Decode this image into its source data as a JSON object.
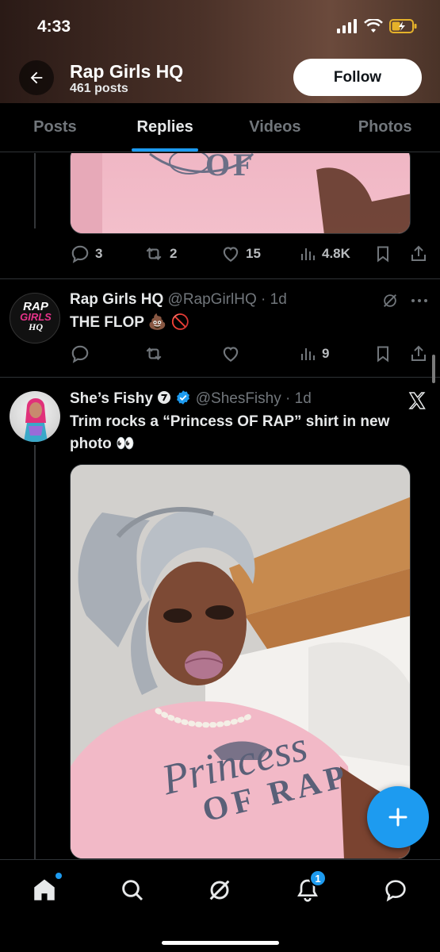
{
  "status_bar": {
    "time": "4:33"
  },
  "header": {
    "account_name": "Rap Girls HQ",
    "post_count": "461 posts",
    "follow_label": "Follow"
  },
  "tabs": [
    {
      "label": "Posts",
      "active": false
    },
    {
      "label": "Replies",
      "active": true
    },
    {
      "label": "Videos",
      "active": false
    },
    {
      "label": "Photos",
      "active": false
    }
  ],
  "posts": [
    {
      "actions": {
        "replies": "3",
        "reposts": "2",
        "likes": "15",
        "views": "4.8K"
      },
      "image_text": "OF"
    },
    {
      "author_name": "Rap Girls HQ",
      "handle": "@RapGirlHQ",
      "time": "1d",
      "text": "THE FLOP 💩 🚫",
      "avatar_text": [
        "RAP",
        "GIRLS",
        "HQ"
      ],
      "actions": {
        "views": "9"
      }
    },
    {
      "author_name": "She’s Fishy",
      "handle": "@ShesFishy",
      "time": "1d",
      "text": "Trim rocks a “Princess OF RAP” shirt in new photo 👀",
      "image_text": [
        "Princess",
        "OF RAP"
      ]
    }
  ],
  "bottom_nav": {
    "notifications_badge": "1"
  },
  "colors": {
    "accent": "#1d9bf0",
    "background": "#000000",
    "muted": "#71767b"
  }
}
